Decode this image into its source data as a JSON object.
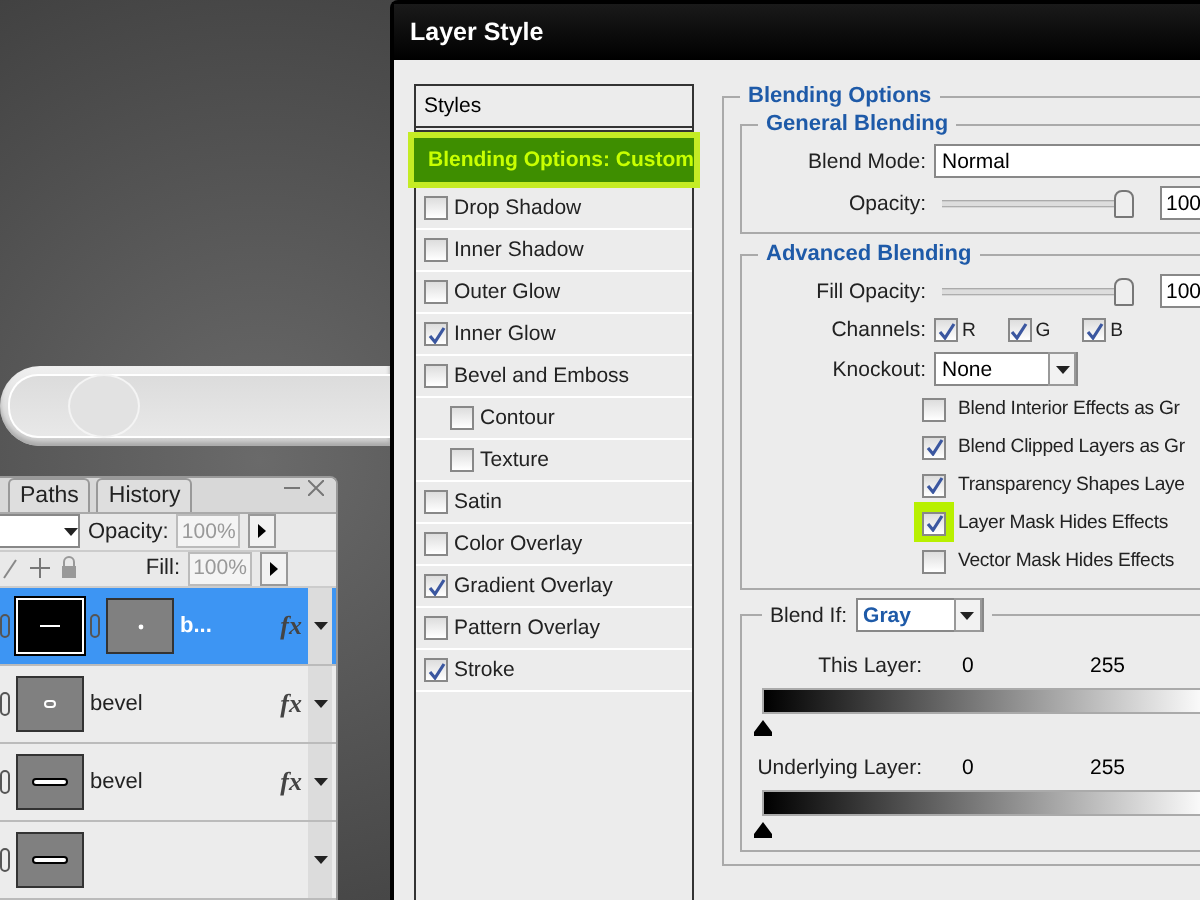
{
  "layers_panel": {
    "tabs": [
      {
        "label": "Paths"
      },
      {
        "label": "History"
      }
    ],
    "opacity_label": "Opacity:",
    "opacity_value": "100%",
    "fill_label": "Fill:",
    "fill_value": "100%",
    "layers": [
      {
        "name": "b...",
        "selected": true,
        "kind": "masked",
        "effects_label": "fx"
      },
      {
        "name": "bevel",
        "selected": false,
        "kind": "dot",
        "effects_label": "fx"
      },
      {
        "name": "bevel",
        "selected": false,
        "kind": "bar",
        "effects_label": "fx"
      },
      {
        "selected": false,
        "kind": "bar"
      }
    ]
  },
  "dialog": {
    "title": "Layer Style",
    "styles_header": "Styles",
    "styles": [
      {
        "label": "Blending Options: Custom",
        "kind": "heading",
        "selected": true,
        "highlighted": true
      },
      {
        "label": "Drop Shadow",
        "kind": "effect",
        "checked": false,
        "selected": false
      },
      {
        "label": "Inner Shadow",
        "kind": "effect",
        "checked": false,
        "selected": false
      },
      {
        "label": "Outer Glow",
        "kind": "effect",
        "checked": false,
        "selected": false
      },
      {
        "label": "Inner Glow",
        "kind": "effect",
        "checked": true,
        "selected": false
      },
      {
        "label": "Bevel and Emboss",
        "kind": "effect",
        "checked": false,
        "selected": false,
        "children": [
          {
            "label": "Contour",
            "kind": "effect",
            "checked": false,
            "selected": false
          },
          {
            "label": "Texture",
            "kind": "effect",
            "checked": false,
            "selected": false
          }
        ]
      },
      {
        "label": "Satin",
        "kind": "effect",
        "checked": false,
        "selected": false
      },
      {
        "label": "Color Overlay",
        "kind": "effect",
        "checked": false,
        "selected": false
      },
      {
        "label": "Gradient Overlay",
        "kind": "effect",
        "checked": true,
        "selected": false
      },
      {
        "label": "Pattern Overlay",
        "kind": "effect",
        "checked": false,
        "selected": false
      },
      {
        "label": "Stroke",
        "kind": "effect",
        "checked": true,
        "selected": false
      }
    ],
    "blending_options": {
      "title": "Blending Options",
      "general": {
        "title": "General Blending",
        "blend_mode_label": "Blend Mode:",
        "blend_mode": "Normal",
        "opacity_label": "Opacity:",
        "opacity": {
          "level": 1
        },
        "opacity_value": "100"
      },
      "advanced": {
        "title": "Advanced Blending",
        "fill_opacity_label": "Fill Opacity:",
        "fill_opacity": {
          "level": 1
        },
        "fill_opacity_value": "100",
        "channels_label": "Channels:",
        "channels": [
          {
            "label": "R",
            "checked": true
          },
          {
            "label": "G",
            "checked": true
          },
          {
            "label": "B",
            "checked": true
          }
        ],
        "knockout_label": "Knockout:",
        "knockout": "None",
        "options": [
          {
            "label": "Blend Interior Effects as Gr",
            "checked": false,
            "highlighted": false
          },
          {
            "label": "Blend Clipped Layers as Gr",
            "checked": true,
            "highlighted": false
          },
          {
            "label": "Transparency Shapes Laye",
            "checked": true,
            "highlighted": false
          },
          {
            "label": "Layer Mask Hides Effects",
            "checked": true,
            "highlighted": true
          },
          {
            "label": "Vector Mask Hides Effects",
            "checked": false,
            "highlighted": false
          }
        ]
      },
      "blend_if": {
        "label": "Blend If:",
        "value": "Gray",
        "ranges": [
          {
            "label": "This Layer:",
            "low": "0",
            "high": "255"
          },
          {
            "label": "Underlying Layer:",
            "low": "0",
            "high": "255"
          }
        ]
      }
    }
  }
}
